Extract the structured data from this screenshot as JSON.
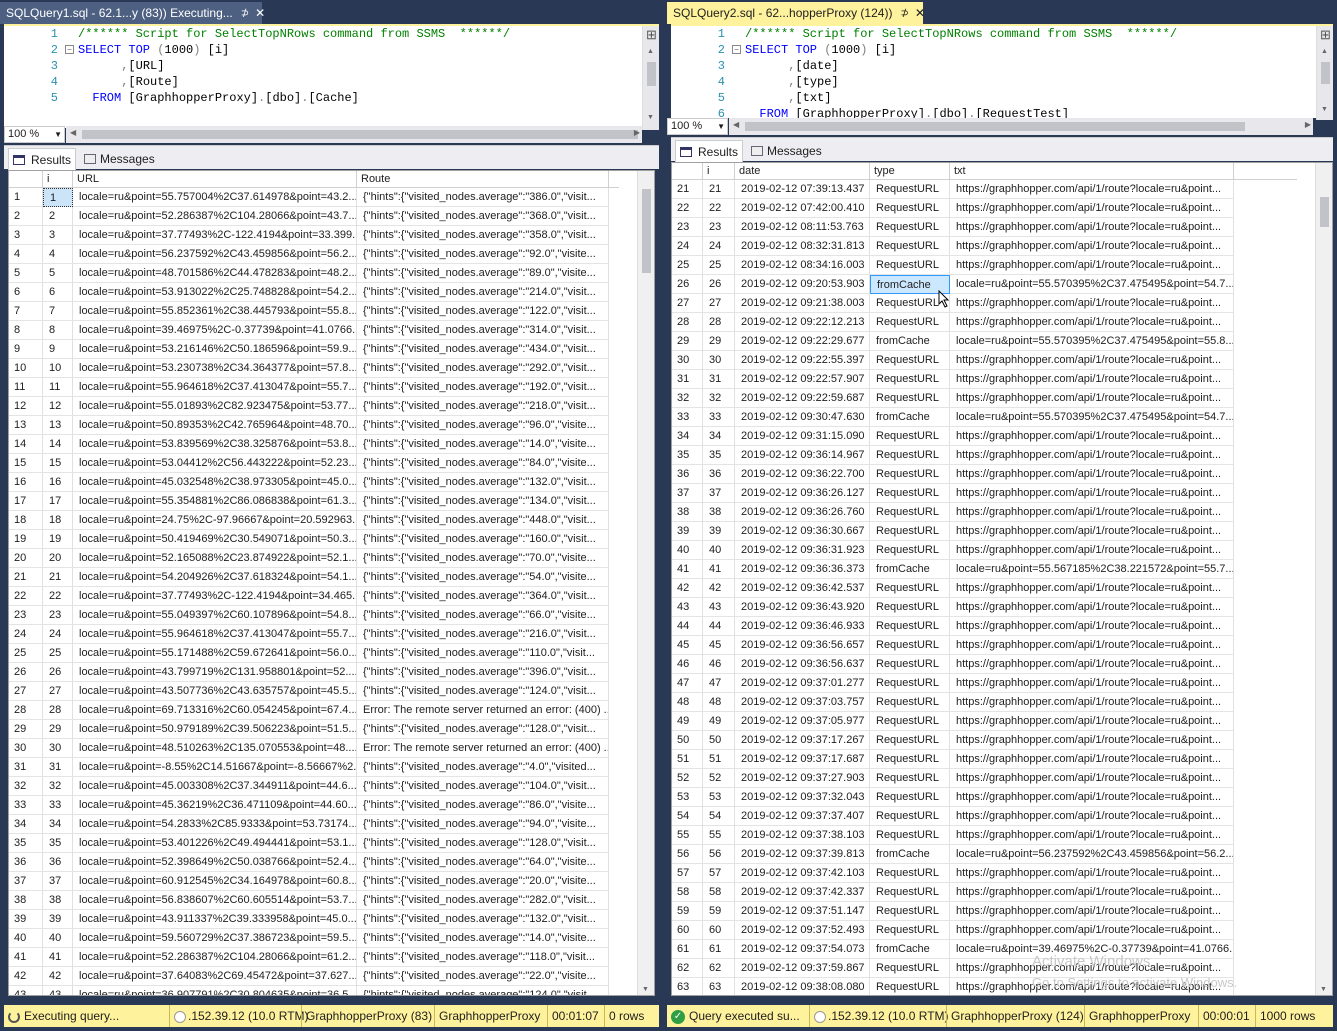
{
  "left": {
    "tab": {
      "title": "SQLQuery1.sql - 62.1...y (83)) Executing...",
      "pin": "⊅",
      "close": "✕"
    },
    "editor": {
      "lines": [
        {
          "n": "1",
          "parts": [
            [
              "cm",
              "/****** Script for SelectTopNRows command from SSMS  ******/"
            ]
          ]
        },
        {
          "n": "2",
          "parts": [
            [
              "kw",
              "SELECT TOP "
            ],
            [
              "gr",
              "("
            ],
            [
              "tx",
              "1000"
            ],
            [
              "gr",
              ")"
            ],
            [
              "tx",
              " [i]"
            ]
          ]
        },
        {
          "n": "3",
          "parts": [
            [
              "gr",
              "      ,"
            ],
            [
              "tx",
              "[URL]"
            ]
          ]
        },
        {
          "n": "4",
          "parts": [
            [
              "gr",
              "      ,"
            ],
            [
              "tx",
              "[Route]"
            ]
          ]
        },
        {
          "n": "5",
          "parts": [
            [
              "kw",
              "  FROM "
            ],
            [
              "tx",
              "[GraphhopperProxy]"
            ],
            [
              "gr",
              "."
            ],
            [
              "tx",
              "[dbo]"
            ],
            [
              "gr",
              "."
            ],
            [
              "tx",
              "[Cache]"
            ]
          ]
        }
      ]
    },
    "zoom": "100 %",
    "results_tab": "Results",
    "messages_tab": "Messages",
    "columns": [
      "",
      "i",
      "URL",
      "Route"
    ],
    "rows": [
      [
        "1",
        "1",
        "locale=ru&point=55.757004%2C37.614978&point=43.2...",
        "{\"hints\":{\"visited_nodes.average\":\"386.0\",\"visit..."
      ],
      [
        "2",
        "2",
        "locale=ru&point=52.286387%2C104.28066&point=43.7...",
        "{\"hints\":{\"visited_nodes.average\":\"368.0\",\"visit..."
      ],
      [
        "3",
        "3",
        "locale=ru&point=37.77493%2C-122.4194&point=33.399...",
        "{\"hints\":{\"visited_nodes.average\":\"358.0\",\"visit..."
      ],
      [
        "4",
        "4",
        "locale=ru&point=56.237592%2C43.459856&point=56.2...",
        "{\"hints\":{\"visited_nodes.average\":\"92.0\",\"visite..."
      ],
      [
        "5",
        "5",
        "locale=ru&point=48.701586%2C44.478283&point=48.2...",
        "{\"hints\":{\"visited_nodes.average\":\"89.0\",\"visite..."
      ],
      [
        "6",
        "6",
        "locale=ru&point=53.913022%2C25.748828&point=54.2...",
        "{\"hints\":{\"visited_nodes.average\":\"214.0\",\"visit..."
      ],
      [
        "7",
        "7",
        "locale=ru&point=55.852361%2C38.445793&point=55.8...",
        "{\"hints\":{\"visited_nodes.average\":\"122.0\",\"visit..."
      ],
      [
        "8",
        "8",
        "locale=ru&point=39.46975%2C-0.37739&point=41.0766...",
        "{\"hints\":{\"visited_nodes.average\":\"314.0\",\"visit..."
      ],
      [
        "9",
        "9",
        "locale=ru&point=53.216146%2C50.186596&point=59.9...",
        "{\"hints\":{\"visited_nodes.average\":\"434.0\",\"visit..."
      ],
      [
        "10",
        "10",
        "locale=ru&point=53.230738%2C34.364377&point=57.8...",
        "{\"hints\":{\"visited_nodes.average\":\"292.0\",\"visit..."
      ],
      [
        "11",
        "11",
        "locale=ru&point=55.964618%2C37.413047&point=55.7...",
        "{\"hints\":{\"visited_nodes.average\":\"192.0\",\"visit..."
      ],
      [
        "12",
        "12",
        "locale=ru&point=55.01893%2C82.923475&point=53.77...",
        "{\"hints\":{\"visited_nodes.average\":\"218.0\",\"visit..."
      ],
      [
        "13",
        "13",
        "locale=ru&point=50.89353%2C42.765964&point=48.70...",
        "{\"hints\":{\"visited_nodes.average\":\"96.0\",\"visite..."
      ],
      [
        "14",
        "14",
        "locale=ru&point=53.839569%2C38.325876&point=53.8...",
        "{\"hints\":{\"visited_nodes.average\":\"14.0\",\"visite..."
      ],
      [
        "15",
        "15",
        "locale=ru&point=53.04412%2C56.443222&point=52.23...",
        "{\"hints\":{\"visited_nodes.average\":\"84.0\",\"visite..."
      ],
      [
        "16",
        "16",
        "locale=ru&point=45.032548%2C38.973305&point=45.0...",
        "{\"hints\":{\"visited_nodes.average\":\"132.0\",\"visit..."
      ],
      [
        "17",
        "17",
        "locale=ru&point=55.354881%2C86.086838&point=61.3...",
        "{\"hints\":{\"visited_nodes.average\":\"134.0\",\"visit..."
      ],
      [
        "18",
        "18",
        "locale=ru&point=24.75%2C-97.96667&point=20.592963...",
        "{\"hints\":{\"visited_nodes.average\":\"448.0\",\"visit..."
      ],
      [
        "19",
        "19",
        "locale=ru&point=50.419469%2C30.549071&point=50.3...",
        "{\"hints\":{\"visited_nodes.average\":\"160.0\",\"visit..."
      ],
      [
        "20",
        "20",
        "locale=ru&point=52.165088%2C23.874922&point=52.1...",
        "{\"hints\":{\"visited_nodes.average\":\"70.0\",\"visite..."
      ],
      [
        "21",
        "21",
        "locale=ru&point=54.204926%2C37.618324&point=54.1...",
        "{\"hints\":{\"visited_nodes.average\":\"54.0\",\"visite..."
      ],
      [
        "22",
        "22",
        "locale=ru&point=37.77493%2C-122.4194&point=34.465...",
        "{\"hints\":{\"visited_nodes.average\":\"364.0\",\"visit..."
      ],
      [
        "23",
        "23",
        "locale=ru&point=55.049397%2C60.107896&point=54.8...",
        "{\"hints\":{\"visited_nodes.average\":\"66.0\",\"visite..."
      ],
      [
        "24",
        "24",
        "locale=ru&point=55.964618%2C37.413047&point=55.7...",
        "{\"hints\":{\"visited_nodes.average\":\"216.0\",\"visit..."
      ],
      [
        "25",
        "25",
        "locale=ru&point=55.171488%2C59.672641&point=56.0...",
        "{\"hints\":{\"visited_nodes.average\":\"110.0\",\"visit..."
      ],
      [
        "26",
        "26",
        "locale=ru&point=43.799719%2C131.958801&point=52....",
        "{\"hints\":{\"visited_nodes.average\":\"396.0\",\"visit..."
      ],
      [
        "27",
        "27",
        "locale=ru&point=43.507736%2C43.635757&point=45.5...",
        "{\"hints\":{\"visited_nodes.average\":\"124.0\",\"visit..."
      ],
      [
        "28",
        "28",
        "locale=ru&point=69.713316%2C60.054245&point=67.4...",
        "Error: The remote server returned an error: (400) ..."
      ],
      [
        "29",
        "29",
        "locale=ru&point=50.979189%2C39.506223&point=51.5...",
        "{\"hints\":{\"visited_nodes.average\":\"128.0\",\"visit..."
      ],
      [
        "30",
        "30",
        "locale=ru&point=48.510263%2C135.070553&point=48....",
        "Error: The remote server returned an error: (400) ..."
      ],
      [
        "31",
        "31",
        "locale=ru&point=-8.55%2C14.51667&point=-8.56667%2...",
        "{\"hints\":{\"visited_nodes.average\":\"4.0\",\"visited..."
      ],
      [
        "32",
        "32",
        "locale=ru&point=45.003308%2C37.344911&point=44.6...",
        "{\"hints\":{\"visited_nodes.average\":\"104.0\",\"visit..."
      ],
      [
        "33",
        "33",
        "locale=ru&point=45.36219%2C36.471109&point=44.60...",
        "{\"hints\":{\"visited_nodes.average\":\"86.0\",\"visite..."
      ],
      [
        "34",
        "34",
        "locale=ru&point=54.2833%2C85.9333&point=53.73174...",
        "{\"hints\":{\"visited_nodes.average\":\"94.0\",\"visite..."
      ],
      [
        "35",
        "35",
        "locale=ru&point=53.401226%2C49.494441&point=53.1...",
        "{\"hints\":{\"visited_nodes.average\":\"128.0\",\"visit..."
      ],
      [
        "36",
        "36",
        "locale=ru&point=52.398649%2C50.038766&point=52.4...",
        "{\"hints\":{\"visited_nodes.average\":\"64.0\",\"visite..."
      ],
      [
        "37",
        "37",
        "locale=ru&point=60.912545%2C34.164978&point=60.8...",
        "{\"hints\":{\"visited_nodes.average\":\"20.0\",\"visite..."
      ],
      [
        "38",
        "38",
        "locale=ru&point=56.838607%2C60.605514&point=53.7...",
        "{\"hints\":{\"visited_nodes.average\":\"282.0\",\"visit..."
      ],
      [
        "39",
        "39",
        "locale=ru&point=43.911337%2C39.333958&point=45.0...",
        "{\"hints\":{\"visited_nodes.average\":\"132.0\",\"visit..."
      ],
      [
        "40",
        "40",
        "locale=ru&point=59.560729%2C37.386723&point=59.5...",
        "{\"hints\":{\"visited_nodes.average\":\"14.0\",\"visite..."
      ],
      [
        "41",
        "41",
        "locale=ru&point=52.286387%2C104.28066&point=61.2...",
        "{\"hints\":{\"visited_nodes.average\":\"118.0\",\"visit..."
      ],
      [
        "42",
        "42",
        "locale=ru&point=37.64083%2C69.45472&point=37.627...",
        "{\"hints\":{\"visited_nodes.average\":\"22.0\",\"visite..."
      ],
      [
        "43",
        "43",
        "locale=ru&point=36.907791%2C30.804635&point=36.5...",
        "{\"hints\":{\"visited_nodes.average\":\"124.0\",\"visit..."
      ]
    ],
    "status": {
      "message": "Executing query...",
      "server": ".152.39.12 (10.0 RTM)",
      "db_session": "GraphhopperProxy (83)",
      "database": "GraphhopperProxy",
      "elapsed": "00:01:07",
      "rows": "0 rows"
    }
  },
  "right": {
    "tab": {
      "title": "SQLQuery2.sql - 62...hopperProxy (124))",
      "pin": "⊅",
      "close": "✕"
    },
    "editor": {
      "lines": [
        {
          "n": "1",
          "parts": [
            [
              "cm",
              "/****** Script for SelectTopNRows command from SSMS  ******/"
            ]
          ]
        },
        {
          "n": "2",
          "parts": [
            [
              "kw",
              "SELECT TOP "
            ],
            [
              "gr",
              "("
            ],
            [
              "tx",
              "1000"
            ],
            [
              "gr",
              ")"
            ],
            [
              "tx",
              " [i]"
            ]
          ]
        },
        {
          "n": "3",
          "parts": [
            [
              "gr",
              "      ,"
            ],
            [
              "tx",
              "[date]"
            ]
          ]
        },
        {
          "n": "4",
          "parts": [
            [
              "gr",
              "      ,"
            ],
            [
              "tx",
              "[type]"
            ]
          ]
        },
        {
          "n": "5",
          "parts": [
            [
              "gr",
              "      ,"
            ],
            [
              "tx",
              "[txt]"
            ]
          ]
        },
        {
          "n": "6",
          "parts": [
            [
              "kw",
              "  FROM "
            ],
            [
              "tx",
              "[GraphhopperProxy]"
            ],
            [
              "gr",
              "."
            ],
            [
              "tx",
              "[dbo]"
            ],
            [
              "gr",
              "."
            ],
            [
              "tx",
              "[RequestTest]"
            ]
          ]
        }
      ]
    },
    "zoom": "100 %",
    "results_tab": "Results",
    "messages_tab": "Messages",
    "columns": [
      "",
      "i",
      "date",
      "type",
      "txt"
    ],
    "rows": [
      [
        "21",
        "21",
        "2019-02-12 07:39:13.437",
        "RequestURL",
        "https://graphhopper.com/api/1/route?locale=ru&point..."
      ],
      [
        "22",
        "22",
        "2019-02-12 07:42:00.410",
        "RequestURL",
        "https://graphhopper.com/api/1/route?locale=ru&point..."
      ],
      [
        "23",
        "23",
        "2019-02-12 08:11:53.763",
        "RequestURL",
        "https://graphhopper.com/api/1/route?locale=ru&point..."
      ],
      [
        "24",
        "24",
        "2019-02-12 08:32:31.813",
        "RequestURL",
        "https://graphhopper.com/api/1/route?locale=ru&point..."
      ],
      [
        "25",
        "25",
        "2019-02-12 08:34:16.003",
        "RequestURL",
        "https://graphhopper.com/api/1/route?locale=ru&point..."
      ],
      [
        "26",
        "26",
        "2019-02-12 09:20:53.903",
        "fromCache",
        "locale=ru&point=55.570395%2C37.475495&point=54.7..."
      ],
      [
        "27",
        "27",
        "2019-02-12 09:21:38.003",
        "RequestURL",
        "https://graphhopper.com/api/1/route?locale=ru&point..."
      ],
      [
        "28",
        "28",
        "2019-02-12 09:22:12.213",
        "RequestURL",
        "https://graphhopper.com/api/1/route?locale=ru&point..."
      ],
      [
        "29",
        "29",
        "2019-02-12 09:22:29.677",
        "fromCache",
        "locale=ru&point=55.570395%2C37.475495&point=55.8..."
      ],
      [
        "30",
        "30",
        "2019-02-12 09:22:55.397",
        "RequestURL",
        "https://graphhopper.com/api/1/route?locale=ru&point..."
      ],
      [
        "31",
        "31",
        "2019-02-12 09:22:57.907",
        "RequestURL",
        "https://graphhopper.com/api/1/route?locale=ru&point..."
      ],
      [
        "32",
        "32",
        "2019-02-12 09:22:59.687",
        "RequestURL",
        "https://graphhopper.com/api/1/route?locale=ru&point..."
      ],
      [
        "33",
        "33",
        "2019-02-12 09:30:47.630",
        "fromCache",
        "locale=ru&point=55.570395%2C37.475495&point=54.7..."
      ],
      [
        "34",
        "34",
        "2019-02-12 09:31:15.090",
        "RequestURL",
        "https://graphhopper.com/api/1/route?locale=ru&point..."
      ],
      [
        "35",
        "35",
        "2019-02-12 09:36:14.967",
        "RequestURL",
        "https://graphhopper.com/api/1/route?locale=ru&point..."
      ],
      [
        "36",
        "36",
        "2019-02-12 09:36:22.700",
        "RequestURL",
        "https://graphhopper.com/api/1/route?locale=ru&point..."
      ],
      [
        "37",
        "37",
        "2019-02-12 09:36:26.127",
        "RequestURL",
        "https://graphhopper.com/api/1/route?locale=ru&point..."
      ],
      [
        "38",
        "38",
        "2019-02-12 09:36:26.760",
        "RequestURL",
        "https://graphhopper.com/api/1/route?locale=ru&point..."
      ],
      [
        "39",
        "39",
        "2019-02-12 09:36:30.667",
        "RequestURL",
        "https://graphhopper.com/api/1/route?locale=ru&point..."
      ],
      [
        "40",
        "40",
        "2019-02-12 09:36:31.923",
        "RequestURL",
        "https://graphhopper.com/api/1/route?locale=ru&point..."
      ],
      [
        "41",
        "41",
        "2019-02-12 09:36:36.373",
        "fromCache",
        "locale=ru&point=55.567185%2C38.221572&point=55.7..."
      ],
      [
        "42",
        "42",
        "2019-02-12 09:36:42.537",
        "RequestURL",
        "https://graphhopper.com/api/1/route?locale=ru&point..."
      ],
      [
        "43",
        "43",
        "2019-02-12 09:36:43.920",
        "RequestURL",
        "https://graphhopper.com/api/1/route?locale=ru&point..."
      ],
      [
        "44",
        "44",
        "2019-02-12 09:36:46.933",
        "RequestURL",
        "https://graphhopper.com/api/1/route?locale=ru&point..."
      ],
      [
        "45",
        "45",
        "2019-02-12 09:36:56.657",
        "RequestURL",
        "https://graphhopper.com/api/1/route?locale=ru&point..."
      ],
      [
        "46",
        "46",
        "2019-02-12 09:36:56.637",
        "RequestURL",
        "https://graphhopper.com/api/1/route?locale=ru&point..."
      ],
      [
        "47",
        "47",
        "2019-02-12 09:37:01.277",
        "RequestURL",
        "https://graphhopper.com/api/1/route?locale=ru&point..."
      ],
      [
        "48",
        "48",
        "2019-02-12 09:37:03.757",
        "RequestURL",
        "https://graphhopper.com/api/1/route?locale=ru&point..."
      ],
      [
        "49",
        "49",
        "2019-02-12 09:37:05.977",
        "RequestURL",
        "https://graphhopper.com/api/1/route?locale=ru&point..."
      ],
      [
        "50",
        "50",
        "2019-02-12 09:37:17.267",
        "RequestURL",
        "https://graphhopper.com/api/1/route?locale=ru&point..."
      ],
      [
        "51",
        "51",
        "2019-02-12 09:37:17.687",
        "RequestURL",
        "https://graphhopper.com/api/1/route?locale=ru&point..."
      ],
      [
        "52",
        "52",
        "2019-02-12 09:37:27.903",
        "RequestURL",
        "https://graphhopper.com/api/1/route?locale=ru&point..."
      ],
      [
        "53",
        "53",
        "2019-02-12 09:37:32.043",
        "RequestURL",
        "https://graphhopper.com/api/1/route?locale=ru&point..."
      ],
      [
        "54",
        "54",
        "2019-02-12 09:37:37.407",
        "RequestURL",
        "https://graphhopper.com/api/1/route?locale=ru&point..."
      ],
      [
        "55",
        "55",
        "2019-02-12 09:37:38.103",
        "RequestURL",
        "https://graphhopper.com/api/1/route?locale=ru&point..."
      ],
      [
        "56",
        "56",
        "2019-02-12 09:37:39.813",
        "fromCache",
        "locale=ru&point=56.237592%2C43.459856&point=56.2..."
      ],
      [
        "57",
        "57",
        "2019-02-12 09:37:42.103",
        "RequestURL",
        "https://graphhopper.com/api/1/route?locale=ru&point..."
      ],
      [
        "58",
        "58",
        "2019-02-12 09:37:42.337",
        "RequestURL",
        "https://graphhopper.com/api/1/route?locale=ru&point..."
      ],
      [
        "59",
        "59",
        "2019-02-12 09:37:51.147",
        "RequestURL",
        "https://graphhopper.com/api/1/route?locale=ru&point..."
      ],
      [
        "60",
        "60",
        "2019-02-12 09:37:52.493",
        "RequestURL",
        "https://graphhopper.com/api/1/route?locale=ru&point..."
      ],
      [
        "61",
        "61",
        "2019-02-12 09:37:54.073",
        "fromCache",
        "locale=ru&point=39.46975%2C-0.37739&point=41.0766..."
      ],
      [
        "62",
        "62",
        "2019-02-12 09:37:59.867",
        "RequestURL",
        "https://graphhopper.com/api/1/route?locale=ru&point..."
      ],
      [
        "63",
        "63",
        "2019-02-12 09:38:08.080",
        "RequestURL",
        "https://graphhopper.com/api/1/route?locale=ru&point..."
      ]
    ],
    "status": {
      "message": "Query executed su...",
      "server": ".152.39.12 (10.0 RTM)",
      "db_session": "GraphhopperProxy (124)",
      "database": "GraphhopperProxy",
      "elapsed": "00:00:01",
      "rows": "1000 rows"
    },
    "watermark": {
      "line1": "Activate Windows",
      "line2": "Go to Settings to activate Windows."
    }
  },
  "colors": {
    "accent_tab": "#fff29d",
    "frame": "#293955",
    "keyword": "#0000ff",
    "comment": "#008000",
    "line_number": "#2b91af"
  },
  "icons": {
    "results": "grid-icon",
    "messages": "messages-icon",
    "executing": "spinner-icon",
    "success": "check-icon",
    "server": "server-icon",
    "split": "split-icon"
  }
}
